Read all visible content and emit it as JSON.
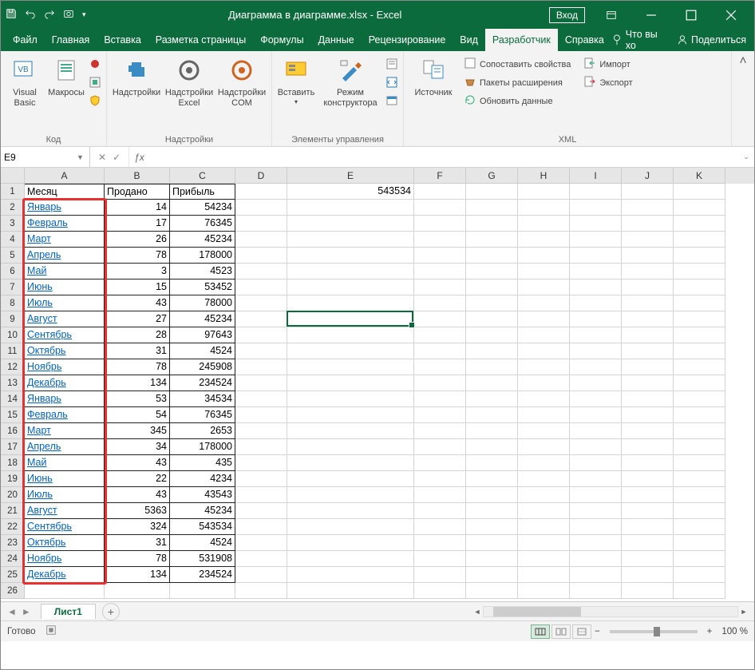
{
  "title": "Диаграмма в диаграмме.xlsx - Excel",
  "login_label": "Вход",
  "tabs": {
    "file": "Файл",
    "home": "Главная",
    "insert": "Вставка",
    "layout": "Разметка страницы",
    "formulas": "Формулы",
    "data": "Данные",
    "review": "Рецензирование",
    "view": "Вид",
    "developer": "Разработчик",
    "help": "Справка",
    "tellme": "Что вы хо",
    "share": "Поделиться"
  },
  "ribbon": {
    "code": {
      "vb": "Visual Basic",
      "macros": "Макросы",
      "label": "Код"
    },
    "addins": {
      "addins": "Надстройки",
      "excel": "Надстройки Excel",
      "com": "Надстройки COM",
      "label": "Надстройки"
    },
    "controls": {
      "insert": "Вставить",
      "design": "Режим конструктора",
      "label": "Элементы управления"
    },
    "xml": {
      "source": "Источник",
      "map": "Сопоставить свойства",
      "expand": "Пакеты расширения",
      "refresh": "Обновить данные",
      "import": "Импорт",
      "export": "Экспорт",
      "label": "XML"
    }
  },
  "namebox": "E9",
  "formula": "",
  "columns": [
    "A",
    "B",
    "C",
    "D",
    "E",
    "F",
    "G",
    "H",
    "I",
    "J",
    "K"
  ],
  "headers": {
    "A": "Месяц",
    "B": "Продано",
    "C": "Прибыль"
  },
  "e1_value": "543534",
  "data_rows": [
    {
      "m": "Январь",
      "s": 14,
      "p": 54234
    },
    {
      "m": "Февраль",
      "s": 17,
      "p": 76345
    },
    {
      "m": "Март",
      "s": 26,
      "p": 45234
    },
    {
      "m": "Апрель",
      "s": 78,
      "p": 178000
    },
    {
      "m": "Май",
      "s": 3,
      "p": 4523
    },
    {
      "m": "Июнь",
      "s": 15,
      "p": 53452
    },
    {
      "m": "Июль",
      "s": 43,
      "p": 78000
    },
    {
      "m": "Август",
      "s": 27,
      "p": 45234
    },
    {
      "m": "Сентябрь",
      "s": 28,
      "p": 97643
    },
    {
      "m": "Октябрь",
      "s": 31,
      "p": 4524
    },
    {
      "m": "Ноябрь",
      "s": 78,
      "p": 245908
    },
    {
      "m": "Декабрь",
      "s": 134,
      "p": 234524
    },
    {
      "m": "Январь",
      "s": 53,
      "p": 34534
    },
    {
      "m": "Февраль",
      "s": 54,
      "p": 76345
    },
    {
      "m": "Март",
      "s": 345,
      "p": 2653
    },
    {
      "m": "Апрель",
      "s": 34,
      "p": 178000
    },
    {
      "m": "Май",
      "s": 43,
      "p": 435
    },
    {
      "m": "Июнь",
      "s": 22,
      "p": 4234
    },
    {
      "m": "Июль",
      "s": 43,
      "p": 43543
    },
    {
      "m": "Август",
      "s": 5363,
      "p": 45234
    },
    {
      "m": "Сентябрь",
      "s": 324,
      "p": 543534
    },
    {
      "m": "Октябрь",
      "s": 31,
      "p": 4524
    },
    {
      "m": "Ноябрь",
      "s": 78,
      "p": 531908
    },
    {
      "m": "Декабрь",
      "s": 134,
      "p": 234524
    }
  ],
  "sheet_tab": "Лист1",
  "status_text": "Готово",
  "zoom": "100 %"
}
